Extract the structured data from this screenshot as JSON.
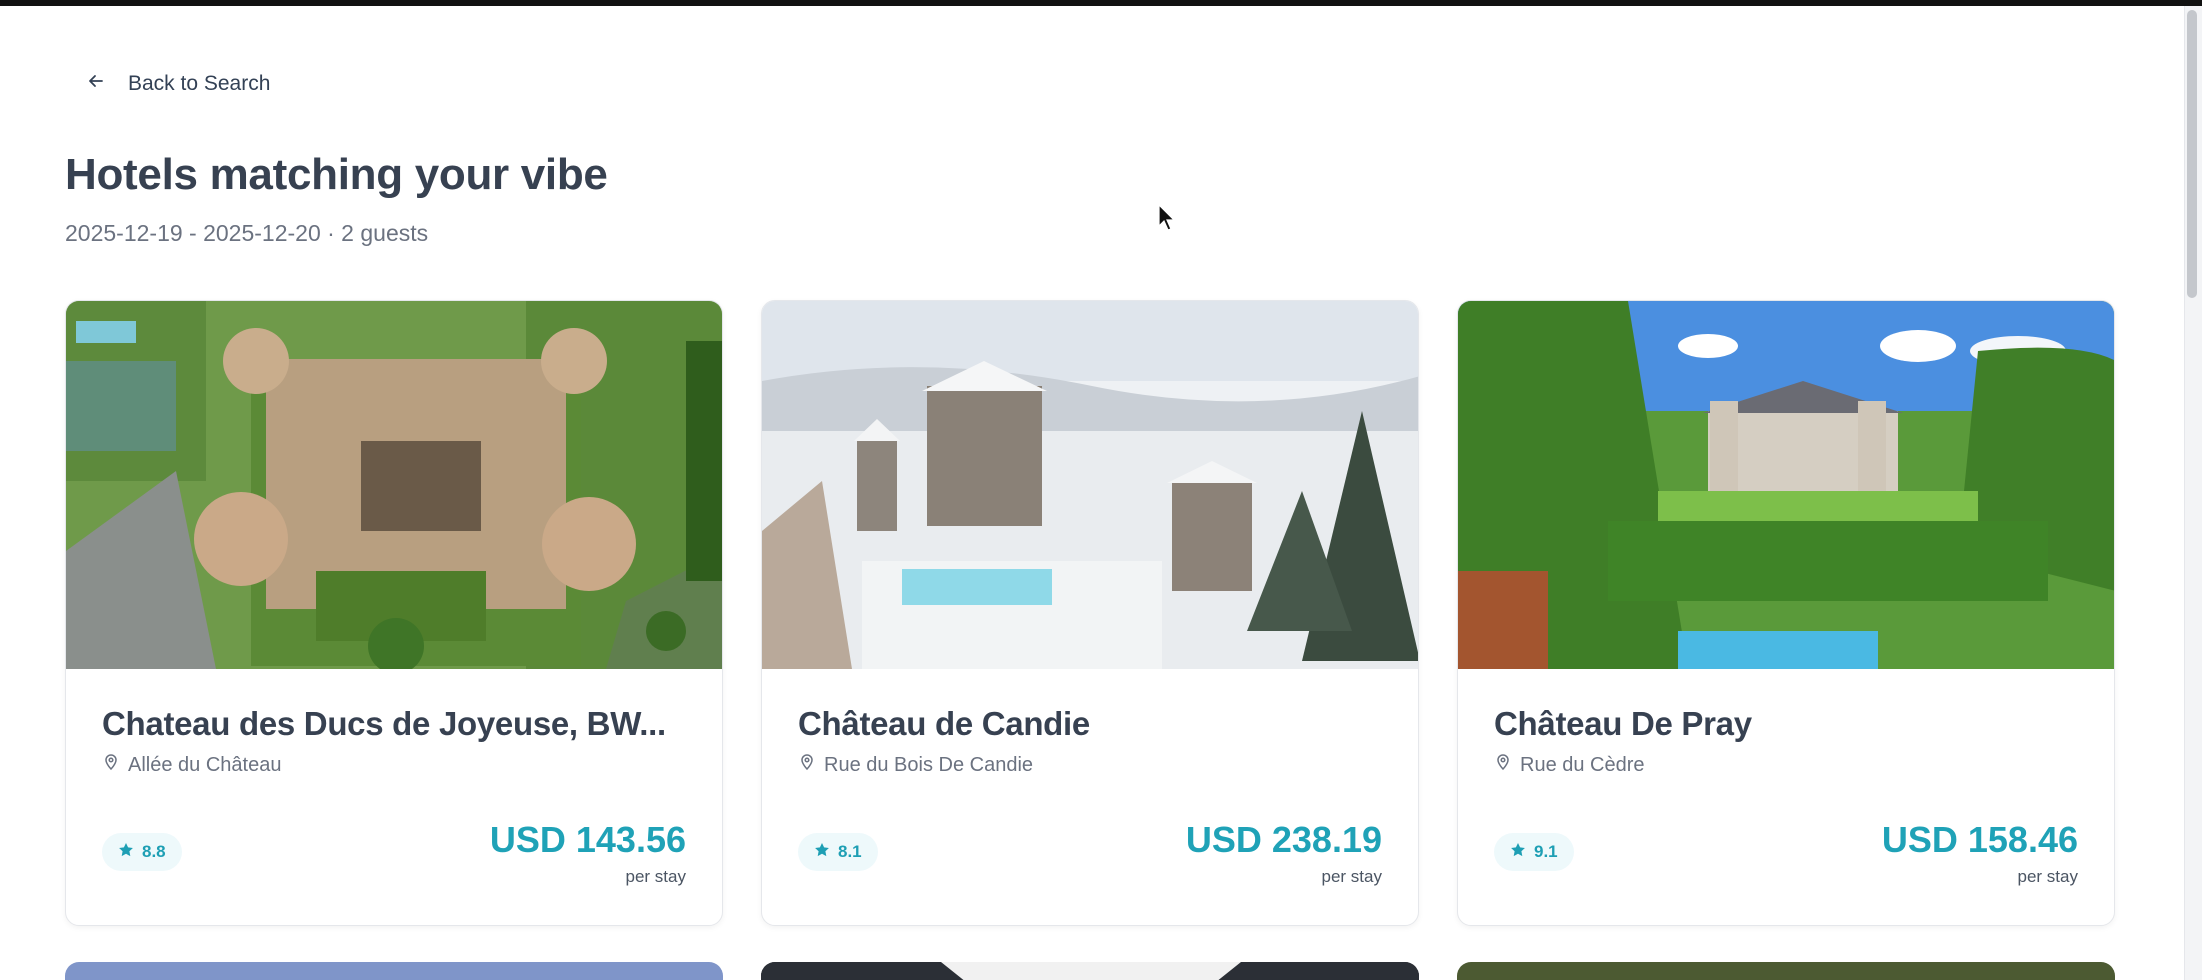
{
  "nav": {
    "back_label": "Back to Search"
  },
  "header": {
    "title": "Hotels matching your vibe",
    "subtitle": "2025-12-19 - 2025-12-20 · 2 guests"
  },
  "hotels": [
    {
      "name": "Chateau des Ducs de Joyeuse, BW...",
      "address": "Allée du Château",
      "rating": "8.8",
      "price": "USD 143.56",
      "price_unit": "per stay"
    },
    {
      "name": "Château de Candie",
      "address": "Rue du Bois De Candie",
      "rating": "8.1",
      "price": "USD 238.19",
      "price_unit": "per stay"
    },
    {
      "name": "Château De Pray",
      "address": "Rue du Cèdre",
      "rating": "9.1",
      "price": "USD 158.46",
      "price_unit": "per stay"
    }
  ],
  "colors": {
    "accent": "#1fa2b7",
    "title": "#374151",
    "muted": "#6b7280"
  },
  "icons": {
    "back": "arrow-left-icon",
    "location": "map-pin-icon",
    "rating": "star-icon"
  }
}
